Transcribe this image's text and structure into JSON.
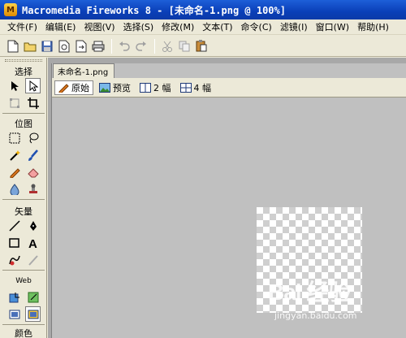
{
  "window": {
    "app_icon_letter": "M",
    "title": "Macromedia Fireworks 8 - [未命名-1.png @ 100%]"
  },
  "menubar": {
    "items": [
      "文件(F)",
      "编辑(E)",
      "视图(V)",
      "选择(S)",
      "修改(M)",
      "文本(T)",
      "命令(C)",
      "滤镜(I)",
      "窗口(W)",
      "帮助(H)"
    ]
  },
  "toolbar": {
    "buttons": [
      "new-file-icon",
      "open-folder-icon",
      "save-icon",
      "import-icon",
      "export-icon",
      "print-icon",
      "undo-icon",
      "redo-icon",
      "cut-icon",
      "copy-icon",
      "paste-icon"
    ]
  },
  "tools": {
    "sections": {
      "select": "选择",
      "bitmap": "位图",
      "vector": "矢量",
      "web": "Web",
      "colors": "颜色"
    }
  },
  "document": {
    "tab_label": "未命名-1.png",
    "view_tabs": [
      "原始",
      "预览",
      "2 幅",
      "4 幅"
    ],
    "active_view": "原始"
  },
  "watermark": {
    "logo": "Bai 经验",
    "url": "jingyan.baidu.com"
  },
  "colors": {
    "titlebar": "#0a3fb8",
    "chrome": "#ece9d8",
    "workspace": "#c0c0c0"
  }
}
